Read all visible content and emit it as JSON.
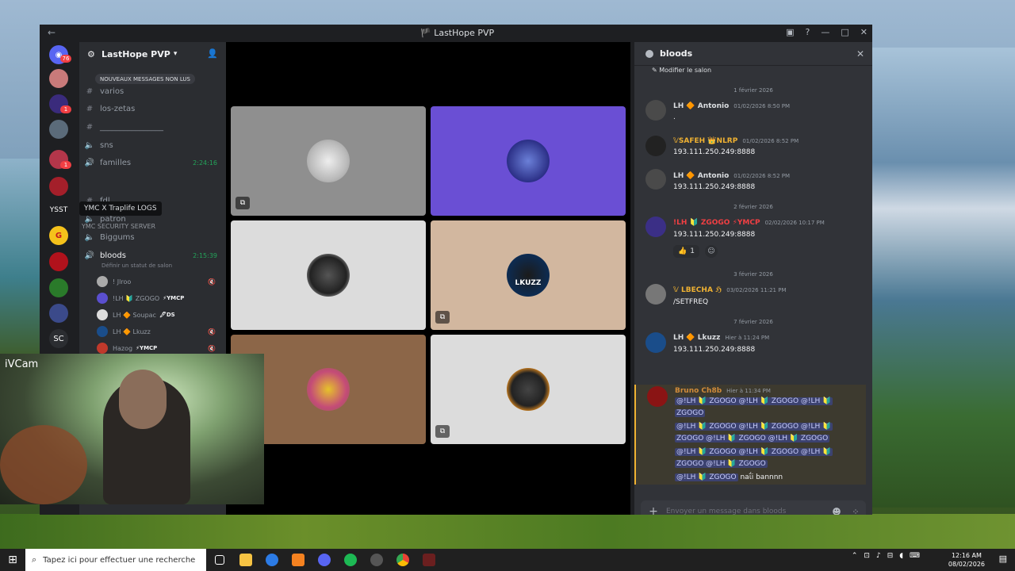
{
  "window": {
    "title": "LastHope PVP",
    "nav_back": "←",
    "nav_forward": "→",
    "controls": [
      "▣",
      "?",
      "—",
      "□",
      "✕"
    ]
  },
  "rail": {
    "badges": [
      "76",
      "1",
      "1"
    ],
    "label_ysst": "YSST",
    "label_sc": "SC"
  },
  "sidebar": {
    "server_name": "LastHope PVP",
    "new_messages": "NOUVEAUX MESSAGES NON LUS",
    "channels": {
      "varios": "varios",
      "los_zetas": "los-zetas",
      "separator": "________________",
      "sns": "sns",
      "familles": "familles",
      "familles_timer": "2:24:16",
      "fdl": "fdl",
      "patron": "patron",
      "biggums": "Biggums",
      "bloods": "bloods",
      "bloods_timer": "2:15:39",
      "bloods_status": "Définir un statut de salon"
    },
    "voice_users": [
      {
        "name": "! Jlroo",
        "tag": ""
      },
      {
        "name": "!LH 🔰 ZGOGO",
        "tag": "⚡YMCP"
      },
      {
        "name": "LH 🔶 Soupac",
        "tag": "🖊DS"
      },
      {
        "name": "LH 🔶 Lkuzz",
        "tag": ""
      },
      {
        "name": "Hazog",
        "tag": "⚡YMCP"
      }
    ],
    "tooltip": "YMC X Traplife LOGS",
    "tooltip2": "YMC SECURITY SERVER"
  },
  "stage": {
    "tile5_text": "LKUZZ"
  },
  "webcam": {
    "label": "iVCam"
  },
  "chat": {
    "channel": "bloods",
    "edit": "Modifier le salon",
    "dividers": [
      "1 février 2026",
      "2 février 2026",
      "3 février 2026",
      "7 février 2026"
    ],
    "messages": [
      {
        "name": "LH 🔶 Antonio",
        "time": "01/02/2026 8:50 PM",
        "text": "."
      },
      {
        "name": "𝕍SAFEH 👑NLRP",
        "time": "01/02/2026 8:52 PM",
        "text": "193.111.250.249:8888"
      },
      {
        "name": "LH 🔶 Antonio",
        "time": "01/02/2026 8:52 PM",
        "text": "193.111.250.249:8888"
      },
      {
        "name": "!LH 🔰 ZGOGO ⚡YMCP",
        "time": "02/02/2026 10:17 PM",
        "text": "193.111.250.249:8888"
      },
      {
        "name": "𝕍 LBECHA ℌ",
        "time": "03/02/2026 11:21 PM",
        "text": "/SETFREQ"
      },
      {
        "name": "LH 🔶 Lkuzz",
        "time": "Hier à 11:24 PM",
        "text": "193.111.250.249:8888"
      },
      {
        "name": "Bruno Ch8b",
        "time": "Hier à 11:34 PM",
        "text": ""
      }
    ],
    "reaction_count": "1",
    "mention_lines": [
      "@!LH 🔰 ZGOGO @!LH 🔰 ZGOGO @!LH 🔰",
      "ZGOGO",
      "@!LH 🔰 ZGOGO @!LH 🔰 ZGOGO @!LH 🔰",
      "ZGOGO @!LH 🔰 ZGOGO @!LH 🔰 ZGOGO",
      "@!LH 🔰 ZGOGO @!LH 🔰 ZGOGO @!LH 🔰",
      "ZGOGO @!LH 🔰 ZGOGO"
    ],
    "last_mention": "@!LH 🔰 ZGOGO",
    "last_plain": " naΐi bannnn",
    "composer_placeholder": "Envoyer un message dans bloods"
  },
  "taskbar": {
    "search_placeholder": "Tapez ici pour effectuer une recherche",
    "time": "12:16 AM",
    "date": "08/02/2026"
  }
}
